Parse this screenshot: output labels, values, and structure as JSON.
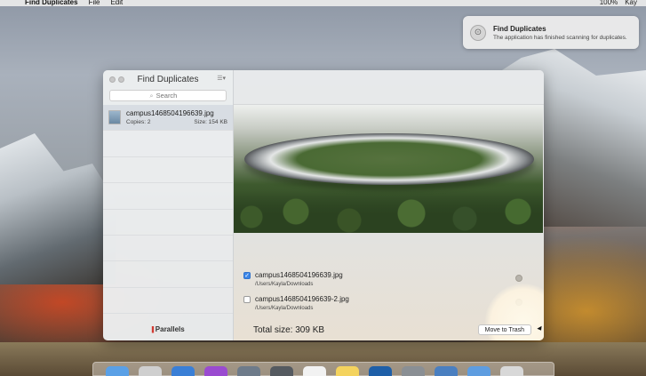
{
  "menubar": {
    "app_name": "Find Duplicates",
    "menus": [
      "File",
      "Edit"
    ],
    "battery": "100%",
    "user": "Kay"
  },
  "notification": {
    "title": "Find Duplicates",
    "body": "The application has finished scanning for duplicates."
  },
  "window": {
    "title": "Find Duplicates",
    "search_placeholder": "Search",
    "group": {
      "filename": "campus1468504196639.jpg",
      "copies": "Copies: 2",
      "size": "Size: 154 KB"
    },
    "footer_brand": "Parallels",
    "duplicates": [
      {
        "name": "campus1468504196639.jpg",
        "path": "/Users/Kayla/Downloads",
        "checked": true
      },
      {
        "name": "campus1468504196639-2.jpg",
        "path": "/Users/Kayla/Downloads",
        "checked": false
      }
    ],
    "total_size": "Total size: 309 KB",
    "trash_button": "Move to Trash"
  },
  "colors": {
    "accent": "#3b86e8",
    "brand_red": "#d0261c"
  },
  "dock": {
    "icons": [
      "finder-icon",
      "photos-icon",
      "safari-icon",
      "siri-icon",
      "launchpad-icon",
      "screenshot-icon",
      "calendar-icon",
      "notes-icon",
      "parallels-icon",
      "settings-icon",
      "downloads-icon",
      "folder-icon",
      "trash-icon"
    ],
    "icon_colors": [
      "#5aa0e6",
      "#cfcfcf",
      "#3a7fd6",
      "#9a4bd0",
      "#6e7b8a",
      "#555a60",
      "#f2f2f2",
      "#f4d35e",
      "#1e5fa8",
      "#8a8f94",
      "#4a7fc0",
      "#5e9de0",
      "#d8d8d8"
    ]
  }
}
